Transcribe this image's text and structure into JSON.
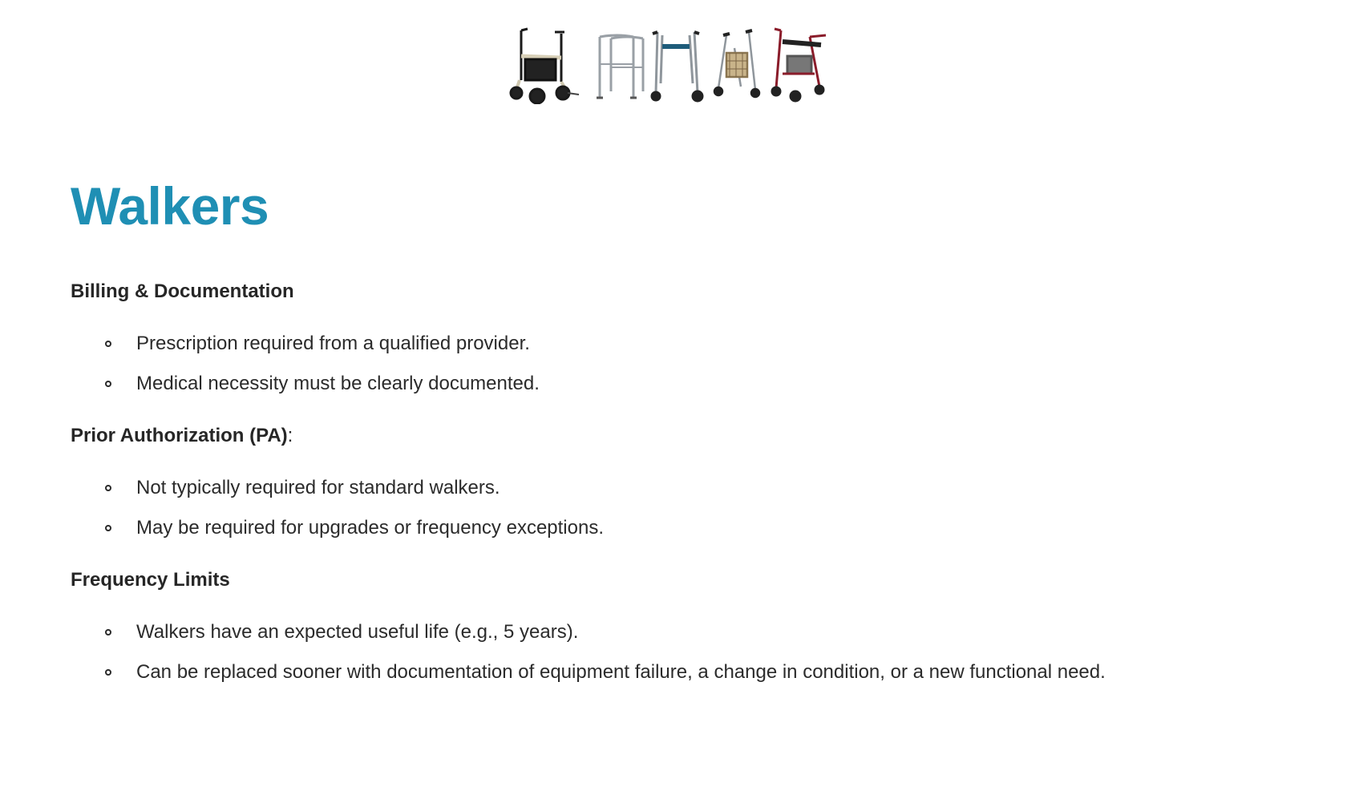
{
  "header_images": {
    "items": [
      "rollator-walker-icon",
      "standard-walker-icon",
      "front-wheeled-walker-icon",
      "three-wheel-rollator-icon",
      "red-rollator-icon"
    ]
  },
  "title": "Walkers",
  "colors": {
    "title": "#1f8fb4",
    "text": "#2b2b2b",
    "background": "#ffffff"
  },
  "sections": [
    {
      "heading": "Billing & Documentation",
      "heading_suffix": "",
      "bullets": [
        "Prescription required from a qualified provider.",
        "Medical necessity must be clearly documented."
      ]
    },
    {
      "heading": "Prior Authorization (PA)",
      "heading_suffix": ":",
      "bullets": [
        "Not typically required for standard walkers.",
        "May be required for upgrades or frequency exceptions."
      ]
    },
    {
      "heading": "Frequency Limits",
      "heading_suffix": "",
      "bullets": [
        "Walkers have an expected useful life (e.g., 5 years).",
        "Can be replaced sooner with documentation of equipment failure, a change in condition, or a new functional need."
      ]
    }
  ]
}
